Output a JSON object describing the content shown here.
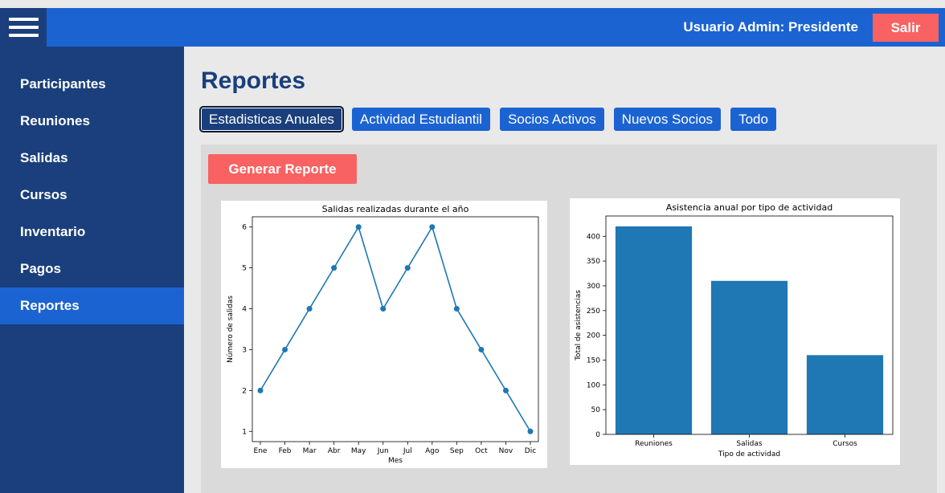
{
  "header": {
    "user_label": "Usuario Admin: Presidente",
    "logout_label": "Salir"
  },
  "sidebar": {
    "items": [
      {
        "label": "Participantes",
        "active": false
      },
      {
        "label": "Reuniones",
        "active": false
      },
      {
        "label": "Salidas",
        "active": false
      },
      {
        "label": "Cursos",
        "active": false
      },
      {
        "label": "Inventario",
        "active": false
      },
      {
        "label": "Pagos",
        "active": false
      },
      {
        "label": "Reportes",
        "active": true
      }
    ]
  },
  "main": {
    "title": "Reportes",
    "tabs": [
      {
        "label": "Estadisticas Anuales",
        "active": true
      },
      {
        "label": "Actividad Estudiantil",
        "active": false
      },
      {
        "label": "Socios Activos",
        "active": false
      },
      {
        "label": "Nuevos Socios",
        "active": false
      },
      {
        "label": "Todo",
        "active": false
      }
    ],
    "generate_label": "Generar Reporte"
  },
  "colors": {
    "topbar": "#1c63d2",
    "sidebar": "#1a3f7c",
    "accent_red": "#f96262",
    "series": "#1f77b4"
  },
  "chart_data": [
    {
      "type": "line",
      "title": "Salidas realizadas durante el año",
      "xlabel": "Mes",
      "ylabel": "Número de salidas",
      "categories": [
        "Ene",
        "Feb",
        "Mar",
        "Abr",
        "May",
        "Jun",
        "Jul",
        "Ago",
        "Sep",
        "Oct",
        "Nov",
        "Dic"
      ],
      "values": [
        2,
        3,
        4,
        5,
        6,
        4,
        5,
        6,
        4,
        3,
        2,
        1
      ],
      "ylim": [
        0.75,
        6.25
      ],
      "yticks": [
        1,
        2,
        3,
        4,
        5,
        6
      ],
      "grid": false
    },
    {
      "type": "bar",
      "title": "Asistencia anual por tipo de actividad",
      "xlabel": "Tipo de actividad",
      "ylabel": "Total de asistencias",
      "categories": [
        "Reuniones",
        "Salidas",
        "Cursos"
      ],
      "values": [
        420,
        310,
        160
      ],
      "ylim": [
        0,
        441
      ],
      "yticks": [
        0,
        50,
        100,
        150,
        200,
        250,
        300,
        350,
        400
      ],
      "grid": false
    }
  ]
}
